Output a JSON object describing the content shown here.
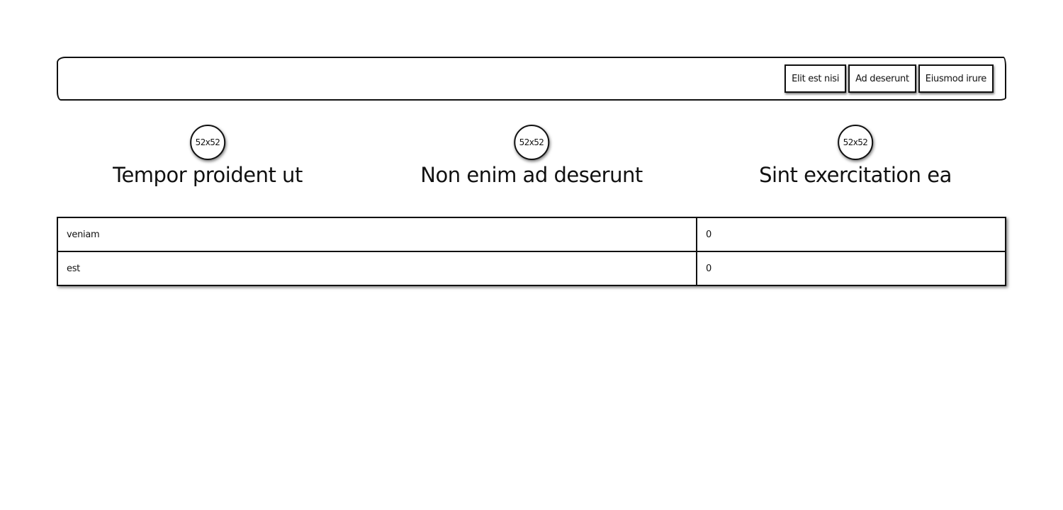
{
  "header": {
    "nav": [
      {
        "label": "Elit est nisi"
      },
      {
        "label": "Ad deserunt"
      },
      {
        "label": "Eiusmod irure"
      }
    ]
  },
  "features": [
    {
      "image_label": "52x52",
      "title": "Tempor proident ut"
    },
    {
      "image_label": "52x52",
      "title": "Non enim ad deserunt"
    },
    {
      "image_label": "52x52",
      "title": "Sint exercitation ea"
    }
  ],
  "table": {
    "rows": [
      {
        "label": "veniam",
        "value": "0"
      },
      {
        "label": "est",
        "value": "0"
      }
    ]
  }
}
